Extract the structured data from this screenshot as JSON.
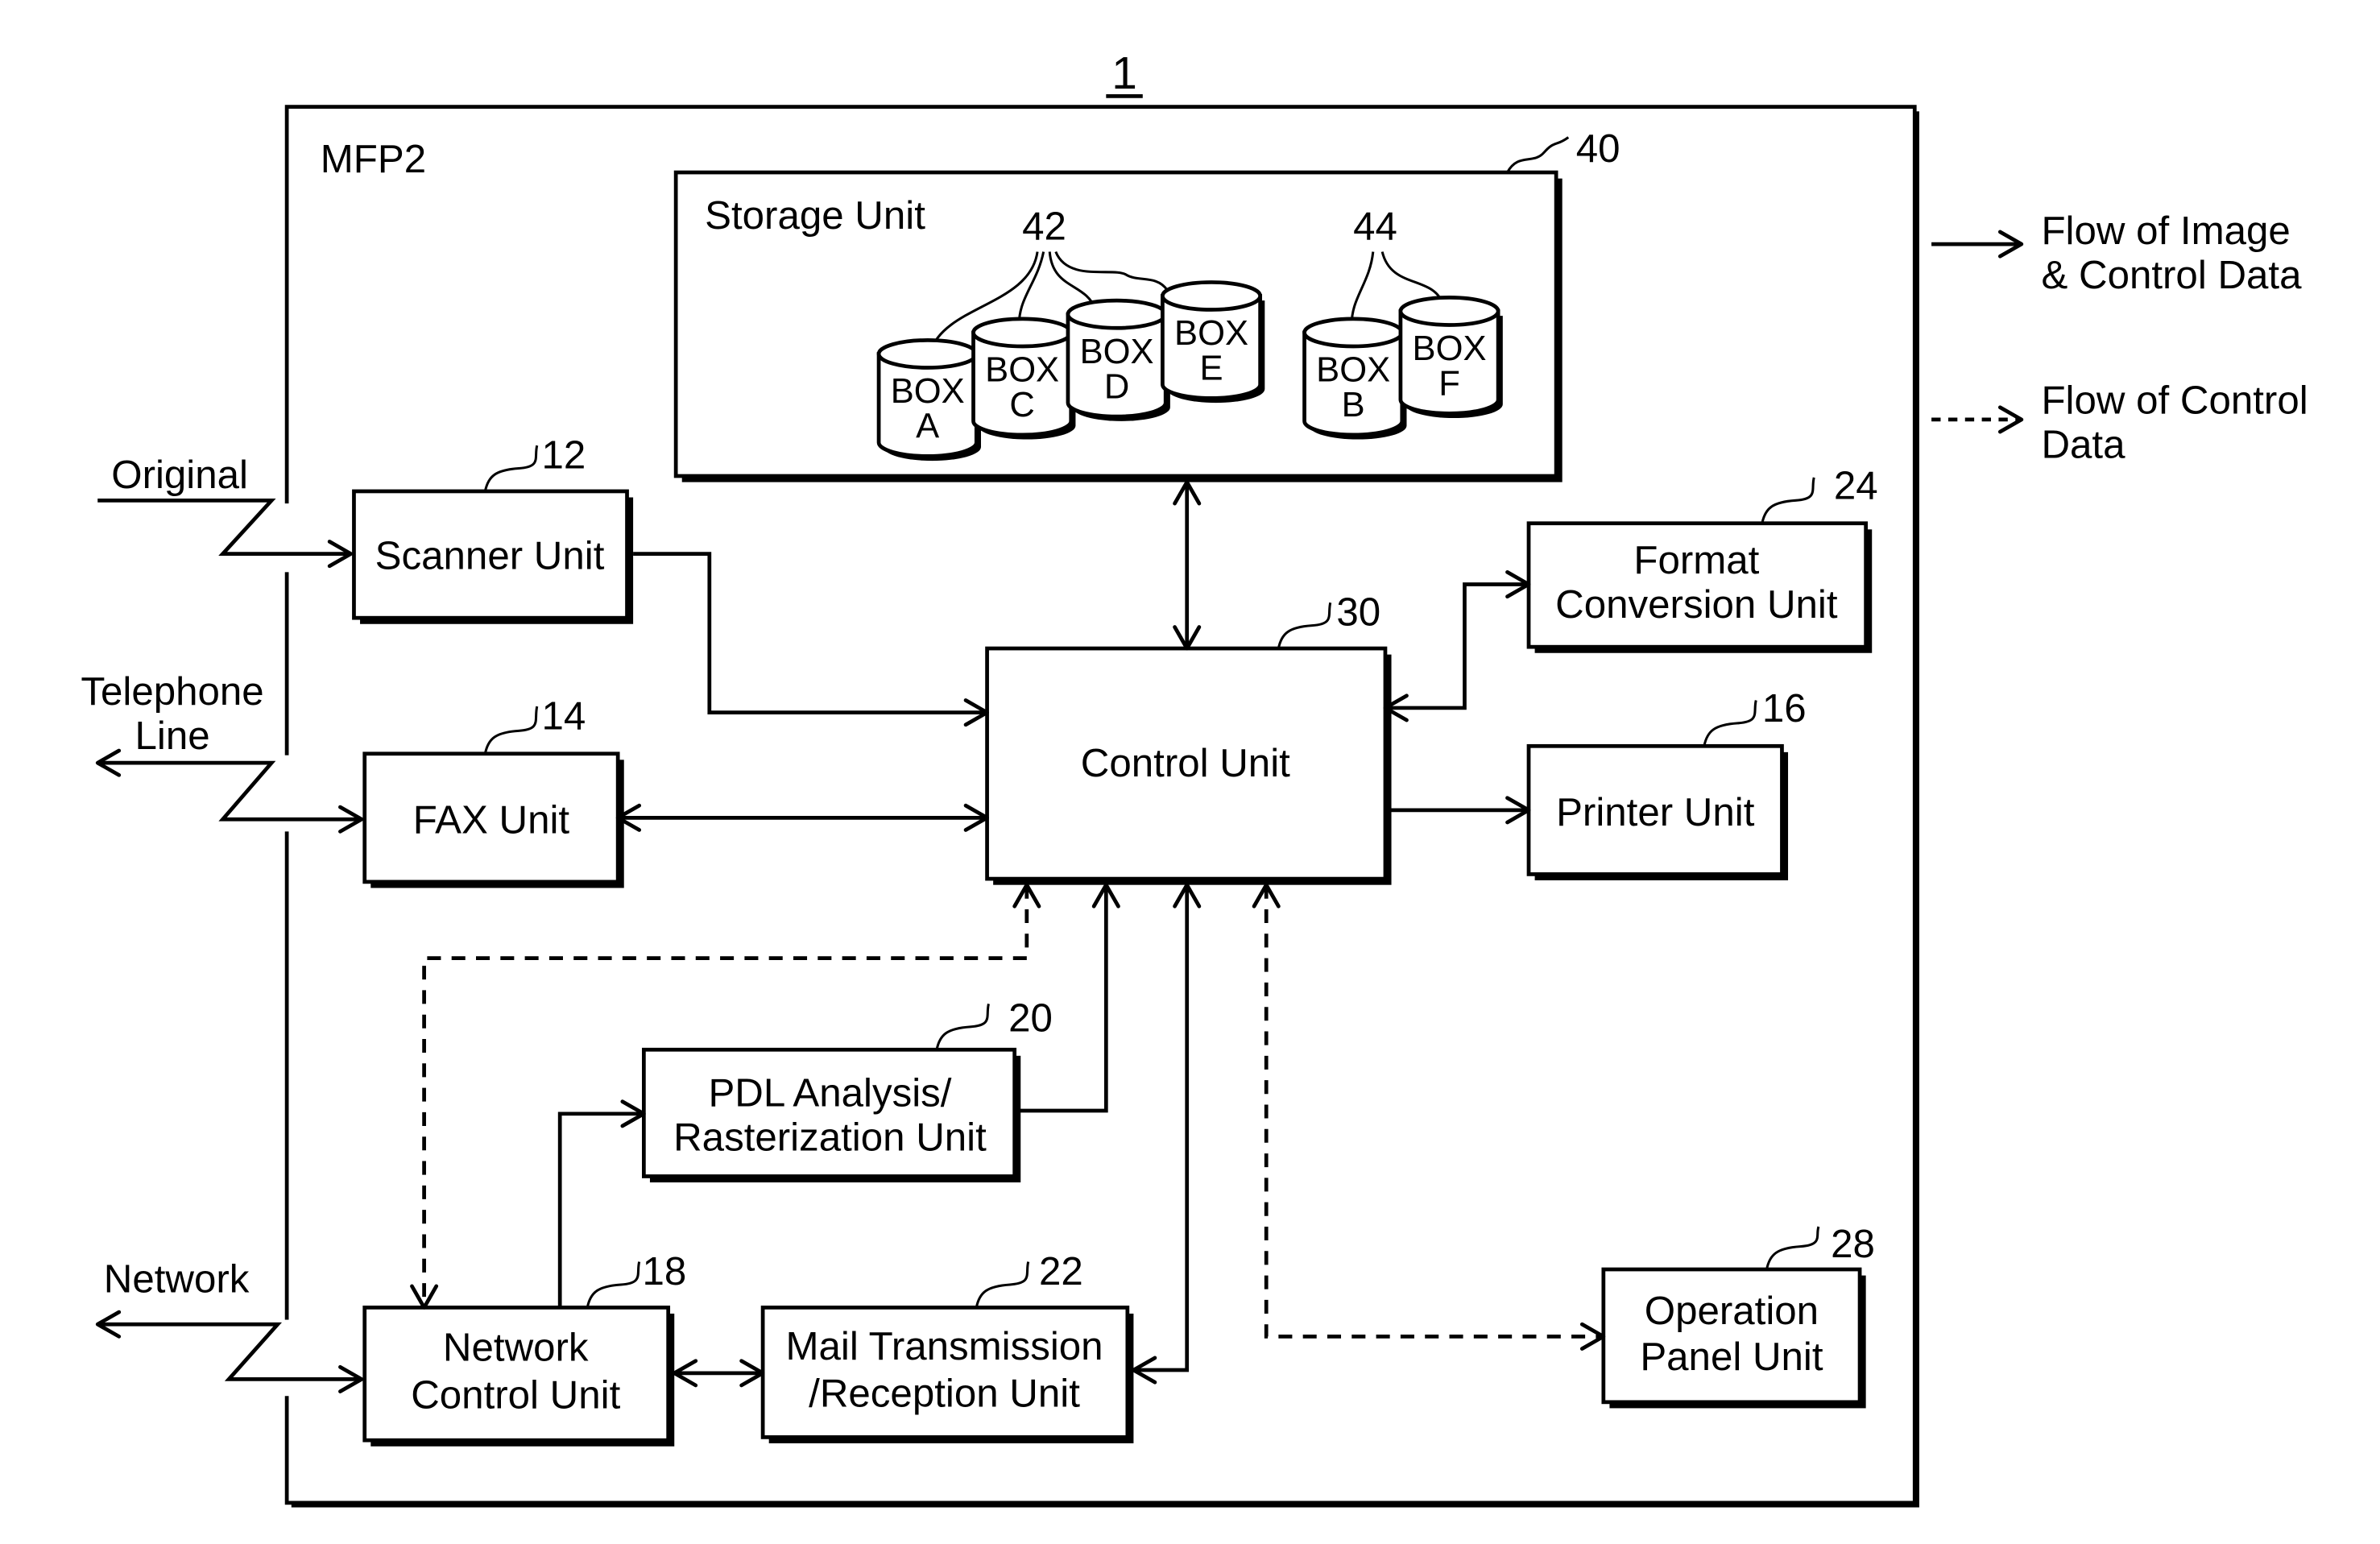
{
  "figure": {
    "reference_number": "1",
    "system_label": "MFP2"
  },
  "external": {
    "original": "Original",
    "telephone_line": [
      "Telephone",
      "Line"
    ],
    "network": "Network"
  },
  "legend": {
    "solid": [
      "Flow of Image",
      "& Control Data"
    ],
    "dashed": [
      "Flow of Control",
      "Data"
    ]
  },
  "storage": {
    "label": "Storage Unit",
    "ref": "40",
    "group_42_ref": "42",
    "group_44_ref": "44",
    "boxes": [
      {
        "top": "BOX",
        "bottom": "A"
      },
      {
        "top": "BOX",
        "bottom": "C"
      },
      {
        "top": "BOX",
        "bottom": "D"
      },
      {
        "top": "BOX",
        "bottom": "E"
      },
      {
        "top": "BOX",
        "bottom": "B"
      },
      {
        "top": "BOX",
        "bottom": "F"
      }
    ]
  },
  "units": {
    "scanner": {
      "lines": [
        "Scanner Unit"
      ],
      "ref": "12"
    },
    "fax": {
      "lines": [
        "FAX Unit"
      ],
      "ref": "14"
    },
    "printer": {
      "lines": [
        "Printer Unit"
      ],
      "ref": "16"
    },
    "network_control": {
      "lines": [
        "Network",
        "Control Unit"
      ],
      "ref": "18"
    },
    "pdl": {
      "lines": [
        "PDL Analysis/",
        "Rasterization Unit"
      ],
      "ref": "20"
    },
    "mail": {
      "lines": [
        "Mail Transmission",
        "/Reception Unit"
      ],
      "ref": "22"
    },
    "format_conversion": {
      "lines": [
        "Format",
        "Conversion Unit"
      ],
      "ref": "24"
    },
    "operation_panel": {
      "lines": [
        "Operation",
        "Panel Unit"
      ],
      "ref": "28"
    },
    "control": {
      "lines": [
        "Control Unit"
      ],
      "ref": "30"
    }
  }
}
